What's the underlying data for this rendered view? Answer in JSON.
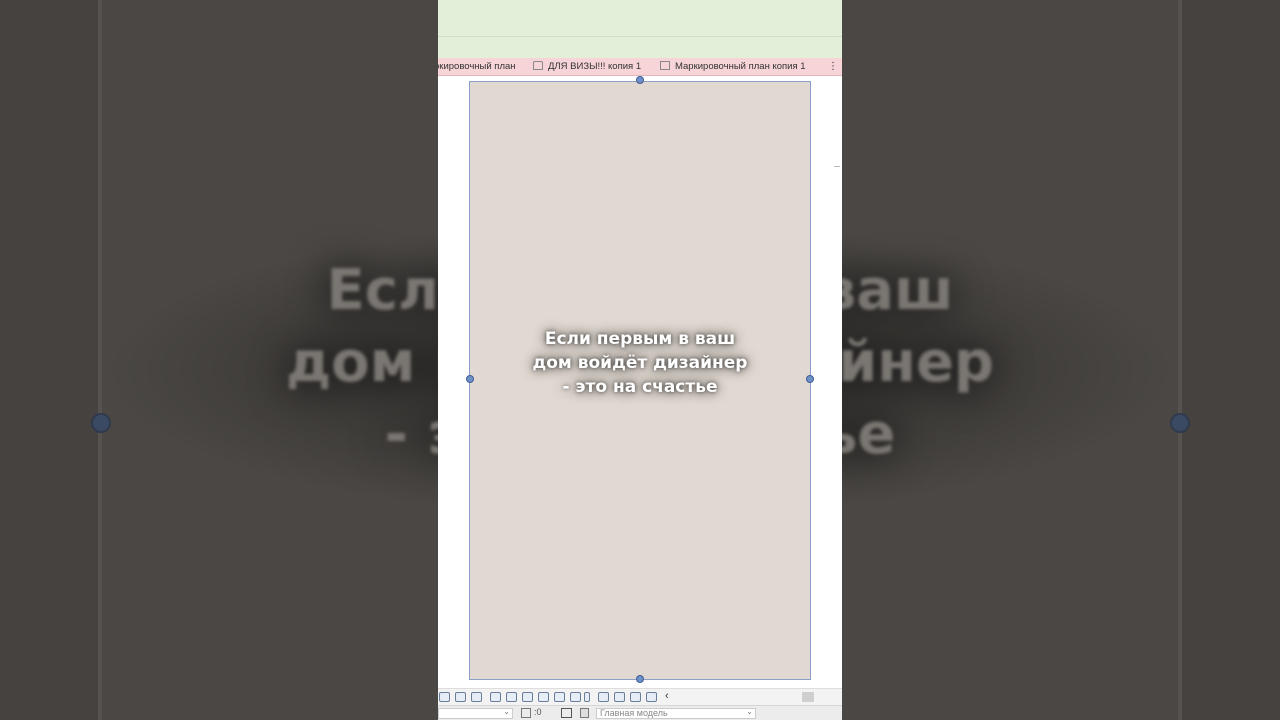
{
  "caption": {
    "line1": "Если первым в ваш",
    "line2": "дом войдёт дизайнер",
    "line3": "- это на счастье"
  },
  "tabs": [
    {
      "label": "ркировочный план",
      "icon": "floorplan-icon"
    },
    {
      "label": "ДЛЯ ВИЗЫ!!! копия 1",
      "icon": "house-icon"
    },
    {
      "label": "Маркировочный план копия 1",
      "icon": "sheet-view-icon"
    }
  ],
  "tabs_end_icon": "footprints-icon",
  "statusbar": {
    "selection_count": ":0",
    "model_select": "Главная модель"
  },
  "colors": {
    "ribbon_bg": "#e3efd9",
    "tabs_bg": "#f6d4d8",
    "sheet_fill": "#e1d9d1",
    "selection_handles": "#6f8fc7",
    "outer_bg": "#454240"
  }
}
